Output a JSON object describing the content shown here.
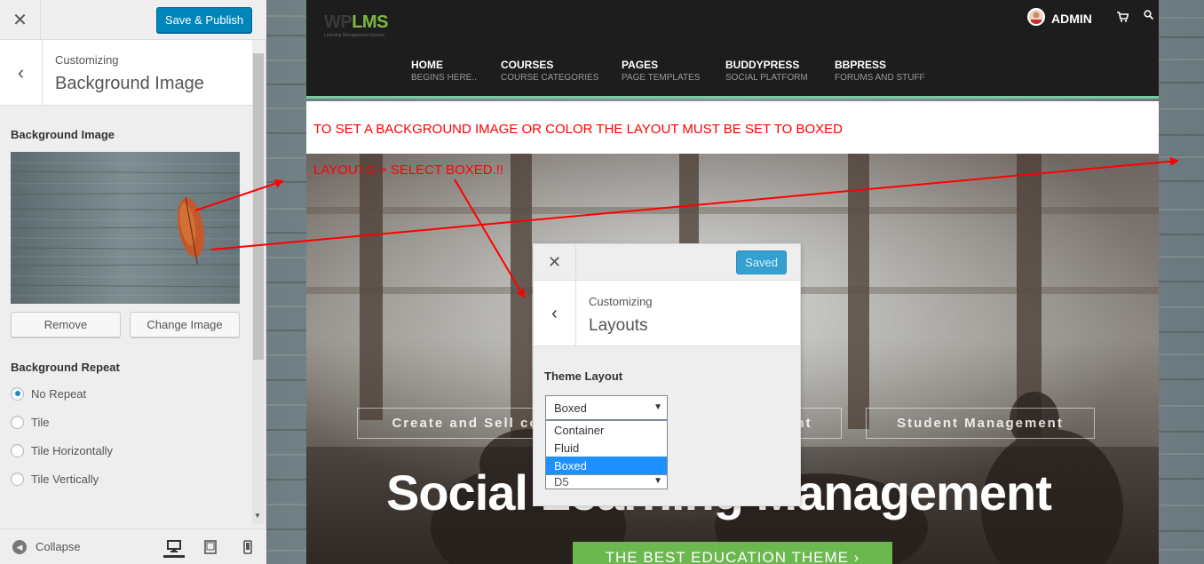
{
  "customizer": {
    "close_label": "✕",
    "save_label": "Save & Publish",
    "back_label": "‹",
    "breadcrumb": "Customizing",
    "section_title": "Background Image",
    "bg_image_label": "Background Image",
    "remove_label": "Remove",
    "change_label": "Change Image",
    "bg_repeat_label": "Background Repeat",
    "repeat_options": [
      {
        "label": "No Repeat",
        "checked": true
      },
      {
        "label": "Tile",
        "checked": false
      },
      {
        "label": "Tile Horizontally",
        "checked": false
      },
      {
        "label": "Tile Vertically",
        "checked": false
      }
    ],
    "collapse_label": "Collapse"
  },
  "site": {
    "logo_wp": "WP",
    "logo_lms": "LMS",
    "logo_sub": "Learning Management System",
    "admin_label": "ADMIN",
    "nav": [
      {
        "label": "HOME",
        "sub": "BEGINS HERE.."
      },
      {
        "label": "COURSES",
        "sub": "COURSE CATEGORIES"
      },
      {
        "label": "PAGES",
        "sub": "PAGE TEMPLATES"
      },
      {
        "label": "BUDDYPRESS",
        "sub": "SOCIAL PLATFORM"
      },
      {
        "label": "BBPRESS",
        "sub": "FORUMS AND STUFF"
      }
    ],
    "notice": "TO SET A BACKGROUND IMAGE OR COLOR THE LAYOUT MUST BE SET TO BOXED",
    "layouts_note": "LAYOUTS-> SELECT BOXED.!!",
    "hero_boxes": [
      "Create and Sell co",
      "nt",
      "Student Management"
    ],
    "hero_title": "Social Learning Management",
    "hero_cta": "THE BEST EDUCATION THEME ›"
  },
  "popup": {
    "close_label": "✕",
    "saved_label": "Saved",
    "back_label": "‹",
    "breadcrumb": "Customizing",
    "title": "Layouts",
    "theme_layout_label": "Theme Layout",
    "selected_value": "Boxed",
    "options": [
      "Container",
      "Fluid",
      "Boxed"
    ],
    "hidden_value": "D5"
  },
  "colors": {
    "primary_button": "#0085ba",
    "annotation_red": "#ff0000",
    "logo_green": "#7fb742",
    "cta_green": "#6ab84e",
    "dropdown_selected": "#1e90ff"
  }
}
